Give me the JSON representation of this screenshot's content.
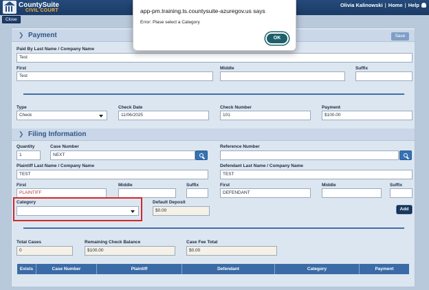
{
  "header": {
    "brand_name": "CountySuite",
    "brand_sub": "CIVIL COURT",
    "user_name": "Olivia Kalinowski",
    "home_link": "Home",
    "help_link": "Help",
    "separator": "|",
    "close_label": "Close"
  },
  "payment": {
    "title": "Payment",
    "save_label": "Save",
    "paid_by_label": "Paid By Last Name / Company Name",
    "paid_by_value": "Test",
    "first_label": "First",
    "first_value": "Test",
    "middle_label": "Middle",
    "middle_value": "",
    "suffix_label": "Suffix",
    "suffix_value": "",
    "type_label": "Type",
    "type_value": "Check",
    "check_date_label": "Check Date",
    "check_date_value": "11/06/2025",
    "check_number_label": "Check Number",
    "check_number_value": "101",
    "payment_label": "Payment",
    "payment_value": "$100.00"
  },
  "filing": {
    "title": "Filing Information",
    "quantity_label": "Quantity",
    "quantity_value": "1",
    "case_number_label": "Case Number",
    "case_number_value": "NEXT",
    "reference_number_label": "Reference Number",
    "reference_number_value": "",
    "plaintiff_last_label": "Plaintiff Last Name / Company Name",
    "plaintiff_last_value": "TEST",
    "defendant_last_label": "Defendant Last Name / Company Name",
    "defendant_last_value": "TEST",
    "p_first_label": "First",
    "p_first_value": "PLAINTIFF",
    "p_middle_label": "Middle",
    "p_suffix_label": "Suffix",
    "d_first_label": "First",
    "d_first_value": "DEFENDANT",
    "d_middle_label": "Middle",
    "d_suffix_label": "Suffix",
    "category_label": "Category",
    "category_value": "",
    "default_deposit_label": "Default Deposit",
    "default_deposit_value": "$0.00",
    "add_label": "Add",
    "total_cases_label": "Total Cases",
    "total_cases_value": "0",
    "remaining_balance_label": "Remaining Check Balance",
    "remaining_balance_value": "$100.00",
    "case_fee_total_label": "Case Fee Total",
    "case_fee_total_value": "$0.00"
  },
  "table": {
    "columns": [
      "Exists",
      "Case Number",
      "Plaintiff",
      "Defendant",
      "Category",
      "Payment"
    ]
  },
  "dialog": {
    "title": "app-pm.training.ts.countysuite-azuregov.us says",
    "message": "Error: Plase select a Category",
    "ok_label": "OK"
  },
  "colors": {
    "header_bg": "#1f3e6b",
    "accent": "#3672b4",
    "highlight_border": "#d2262a",
    "ok_button": "#1e5f6b"
  },
  "icons": {
    "search": "search-icon",
    "chevron": "chevron-down-icon",
    "user": "user-icon",
    "logo": "courthouse-logo"
  }
}
